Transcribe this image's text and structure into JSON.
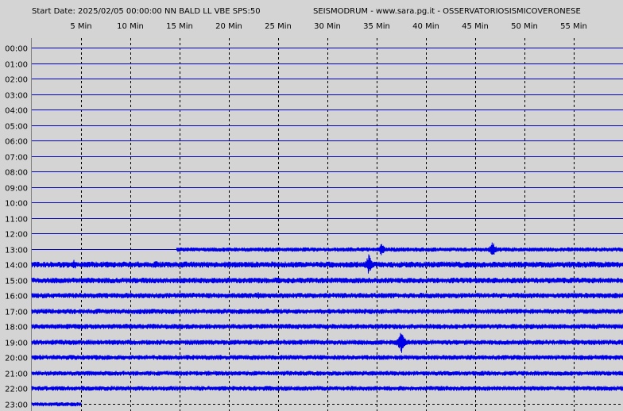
{
  "header": {
    "left": "Start Date: 2025/02/05 00:00:00 NN BALD LL VBE SPS:50",
    "right": "SEISMODRUM - www.sara.pg.it - OSSERVATORIOSISMICOVERONESE"
  },
  "colors": {
    "plot_background": "#d4d4d4",
    "trace": "#0000e6",
    "grid_solid": "#0000c0",
    "grid_dashed": "#000000",
    "text": "#000000"
  },
  "chart_data": {
    "type": "line",
    "x_tick_labels": [
      "5 Min",
      "10 Min",
      "15 Min",
      "20 Min",
      "25 Min",
      "30 Min",
      "35 Min",
      "40 Min",
      "45 Min",
      "50 Min",
      "55 Min"
    ],
    "x_ticks_minutes": [
      5,
      10,
      15,
      20,
      25,
      30,
      35,
      40,
      45,
      50,
      55
    ],
    "xlim_minutes": [
      0,
      60
    ],
    "y_tick_labels": [
      "00:00",
      "01:00",
      "02:00",
      "03:00",
      "04:00",
      "05:00",
      "06:00",
      "07:00",
      "08:00",
      "09:00",
      "10:00",
      "11:00",
      "12:00",
      "13:00",
      "14:00",
      "15:00",
      "16:00",
      "17:00",
      "18:00",
      "19:00",
      "20:00",
      "21:00",
      "22:00",
      "23:00"
    ],
    "grid": true,
    "traces": [
      {
        "hour": "13:00",
        "start_min": 14.7,
        "end_min": 60,
        "amplitude": 2.3,
        "events": [
          {
            "min": 35.5,
            "amp": 8
          },
          {
            "min": 46.8,
            "amp": 11
          }
        ]
      },
      {
        "hour": "14:00",
        "start_min": 0,
        "end_min": 60,
        "amplitude": 3.2,
        "events": [
          {
            "min": 34.2,
            "amp": 13
          },
          {
            "min": 4.3,
            "amp": 6
          },
          {
            "min": 12.6,
            "amp": 5
          }
        ]
      },
      {
        "hour": "15:00",
        "start_min": 0,
        "end_min": 60,
        "amplitude": 3.0,
        "events": []
      },
      {
        "hour": "16:00",
        "start_min": 0,
        "end_min": 60,
        "amplitude": 2.8,
        "events": [
          {
            "min": 23,
            "amp": 5
          }
        ]
      },
      {
        "hour": "17:00",
        "start_min": 0,
        "end_min": 60,
        "amplitude": 2.7,
        "events": []
      },
      {
        "hour": "18:00",
        "start_min": 0,
        "end_min": 60,
        "amplitude": 2.7,
        "events": []
      },
      {
        "hour": "19:00",
        "start_min": 0,
        "end_min": 60,
        "amplitude": 2.7,
        "events": [
          {
            "min": 37.5,
            "amp": 16
          }
        ]
      },
      {
        "hour": "20:00",
        "start_min": 0,
        "end_min": 60,
        "amplitude": 2.6,
        "events": []
      },
      {
        "hour": "21:00",
        "start_min": 0,
        "end_min": 60,
        "amplitude": 2.5,
        "events": []
      },
      {
        "hour": "22:00",
        "start_min": 0,
        "end_min": 60,
        "amplitude": 2.5,
        "events": []
      },
      {
        "hour": "23:00",
        "start_min": 0,
        "end_min": 5,
        "amplitude": 2.2,
        "events": []
      }
    ]
  }
}
